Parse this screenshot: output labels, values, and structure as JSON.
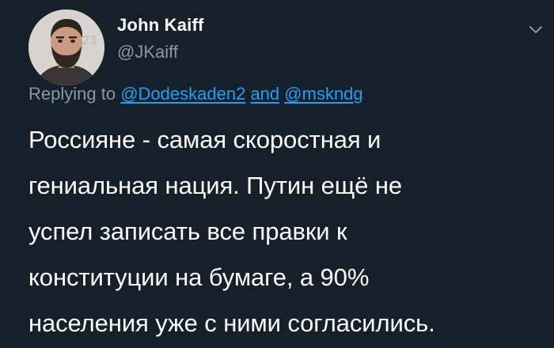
{
  "tweet": {
    "author": {
      "display_name": "John Kaiff",
      "handle": "@JKaiff",
      "avatar": "avatar-photo-bearded-man"
    },
    "menu_icon": "chevron-down-icon",
    "reply": {
      "prefix": "Replying to",
      "mention_1": "@Dodeskaden2",
      "conjunction": "and",
      "mention_2": "@mskndg"
    },
    "text_lines": [
      "Россияне - самая скоростная и",
      "гениальная нация. Путин ещё не",
      "успел записать все правки к",
      "конституции на бумаге, а 90%",
      "населения уже с ними согласились."
    ]
  },
  "colors": {
    "background": "#15202b",
    "primary_text": "#ffffff",
    "secondary_text": "#8899a6",
    "link": "#1da1f2"
  }
}
